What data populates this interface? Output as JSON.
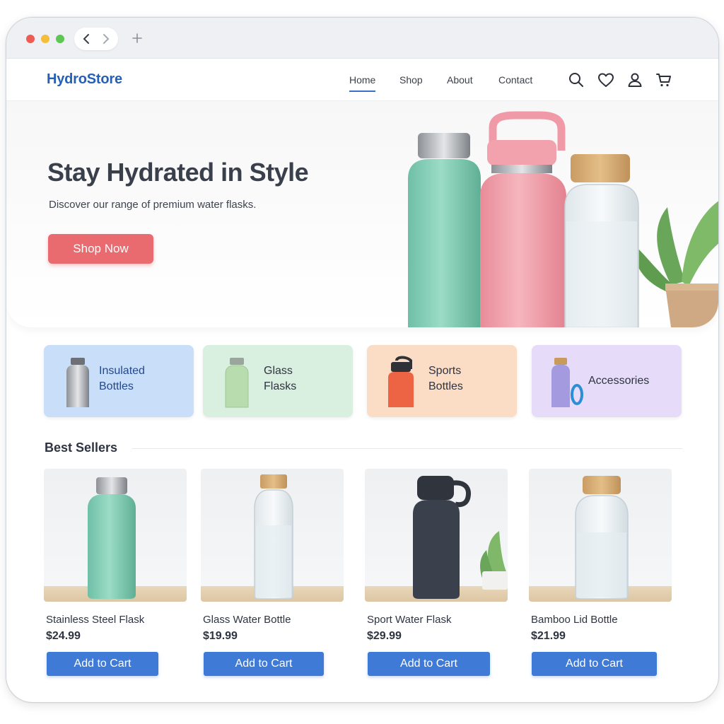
{
  "site": {
    "logo": "HydroStore"
  },
  "nav": {
    "items": [
      {
        "label": "Home",
        "active": true
      },
      {
        "label": "Shop"
      },
      {
        "label": "About"
      },
      {
        "label": "Contact"
      }
    ],
    "icons": [
      "search-icon",
      "heart-icon",
      "user-icon",
      "cart-icon"
    ]
  },
  "hero": {
    "title": "Stay Hydrated in Style",
    "subtitle": "Discover our range of premium water flasks.",
    "cta": "Shop Now",
    "cta_color": "#e96b70"
  },
  "categories": [
    {
      "label": "Insulated\nBottles",
      "color": "#c9def9"
    },
    {
      "label": "Glass\nFlasks",
      "color": "#d9efdf"
    },
    {
      "label": "Sports\nBottles",
      "color": "#fbdcc4"
    },
    {
      "label": "Accessories",
      "color": "#e6dbf8"
    }
  ],
  "best_sellers": {
    "title": "Best Sellers",
    "products": [
      {
        "name": "Stainless Steel Flask",
        "price": "$24.99",
        "button": "Add to Cart"
      },
      {
        "name": "Glass Water Bottle",
        "price": "$19.99",
        "button": "Add to Cart"
      },
      {
        "name": "Sport Water Flask",
        "price": "$29.99",
        "button": "Add to Cart"
      },
      {
        "name": "Bamboo Lid Bottle",
        "price": "$21.99",
        "button": "Add to Cart"
      }
    ]
  },
  "colors": {
    "accent": "#3f7bd6",
    "brand": "#2560b8"
  }
}
